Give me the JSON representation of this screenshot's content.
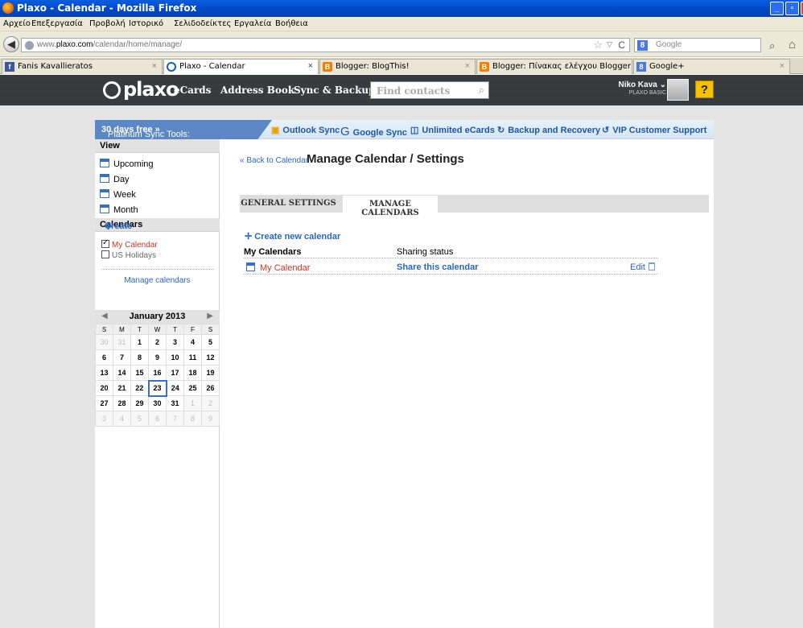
{
  "window": {
    "title": "Plaxo - Calendar - Mozilla Firefox"
  },
  "menu": [
    "Αρχείο",
    "Επεξεργασία",
    "Προβολή",
    "Ιστορικό",
    "Σελιδοδείκτες",
    "Εργαλεία",
    "Βοήθεια"
  ],
  "nav": {
    "url_prefix": "www.",
    "url_domain": "plaxo.com",
    "url_path": "/calendar/home/manage/",
    "search_placeholder": "Google"
  },
  "tabs": [
    {
      "label": "Fanis Kavallieratos",
      "favicon": "f"
    },
    {
      "label": "Plaxo - Calendar",
      "favicon": ""
    },
    {
      "label": "Blogger: BlogThis!",
      "favicon": "B"
    },
    {
      "label": "Blogger: Πίνακας ελέγχου Blogger",
      "favicon": "B"
    },
    {
      "label": "Google+",
      "favicon": "8"
    }
  ],
  "plaxo": {
    "logo": "plaxo",
    "nav": [
      "eCards",
      "Address Book",
      "Sync & Backup"
    ],
    "find_placeholder": "Find contacts",
    "user_name": "Niko Kava",
    "user_plan": "PLAXO BASIC",
    "help_label": "?"
  },
  "promo": {
    "lead": "Platinum Sync Tools:",
    "lead_bold": "30 days free »",
    "tools": [
      "Outlook Sync",
      "Google Sync",
      "Unlimited eCards",
      "Backup and Recovery",
      "VIP Customer Support"
    ]
  },
  "sidebar": {
    "view_title": "View",
    "views": [
      "Upcoming",
      "Day",
      "Week",
      "Month"
    ],
    "calendars_title": "Calendars",
    "create_label": "Create",
    "calendars": [
      {
        "label": "My Calendar",
        "checked": true,
        "color": "#c0392b"
      },
      {
        "label": "US Holidays",
        "checked": false,
        "color": "#666666"
      }
    ],
    "manage_label": "Manage calendars"
  },
  "minical": {
    "month": "January 2013",
    "dow": [
      "S",
      "M",
      "T",
      "W",
      "T",
      "F",
      "S"
    ],
    "weeks": [
      [
        "30",
        "31",
        "1",
        "2",
        "3",
        "4",
        "5"
      ],
      [
        "6",
        "7",
        "8",
        "9",
        "10",
        "11",
        "12"
      ],
      [
        "13",
        "14",
        "15",
        "16",
        "17",
        "18",
        "19"
      ],
      [
        "20",
        "21",
        "22",
        "23",
        "24",
        "25",
        "26"
      ],
      [
        "27",
        "28",
        "29",
        "30",
        "31",
        "1",
        "2"
      ],
      [
        "3",
        "4",
        "5",
        "6",
        "7",
        "8",
        "9"
      ]
    ],
    "today": "23"
  },
  "main": {
    "back_link": "« Back to Calendar",
    "title": "Manage Calendar / Settings",
    "tabs": [
      "GENERAL SETTINGS",
      "MANAGE CALENDARS"
    ],
    "active_tab": "MANAGE CALENDARS",
    "create_new": "Create new calendar",
    "col_calendars": "My Calendars",
    "col_sharing": "Sharing status",
    "rows": [
      {
        "name": "My Calendar",
        "sharing": "Share this calendar",
        "edit": "Edit"
      }
    ]
  },
  "colors": {
    "link": "#2a67bd",
    "header_bg": "#3c3e42",
    "titlebar": "#0a5ee0"
  }
}
